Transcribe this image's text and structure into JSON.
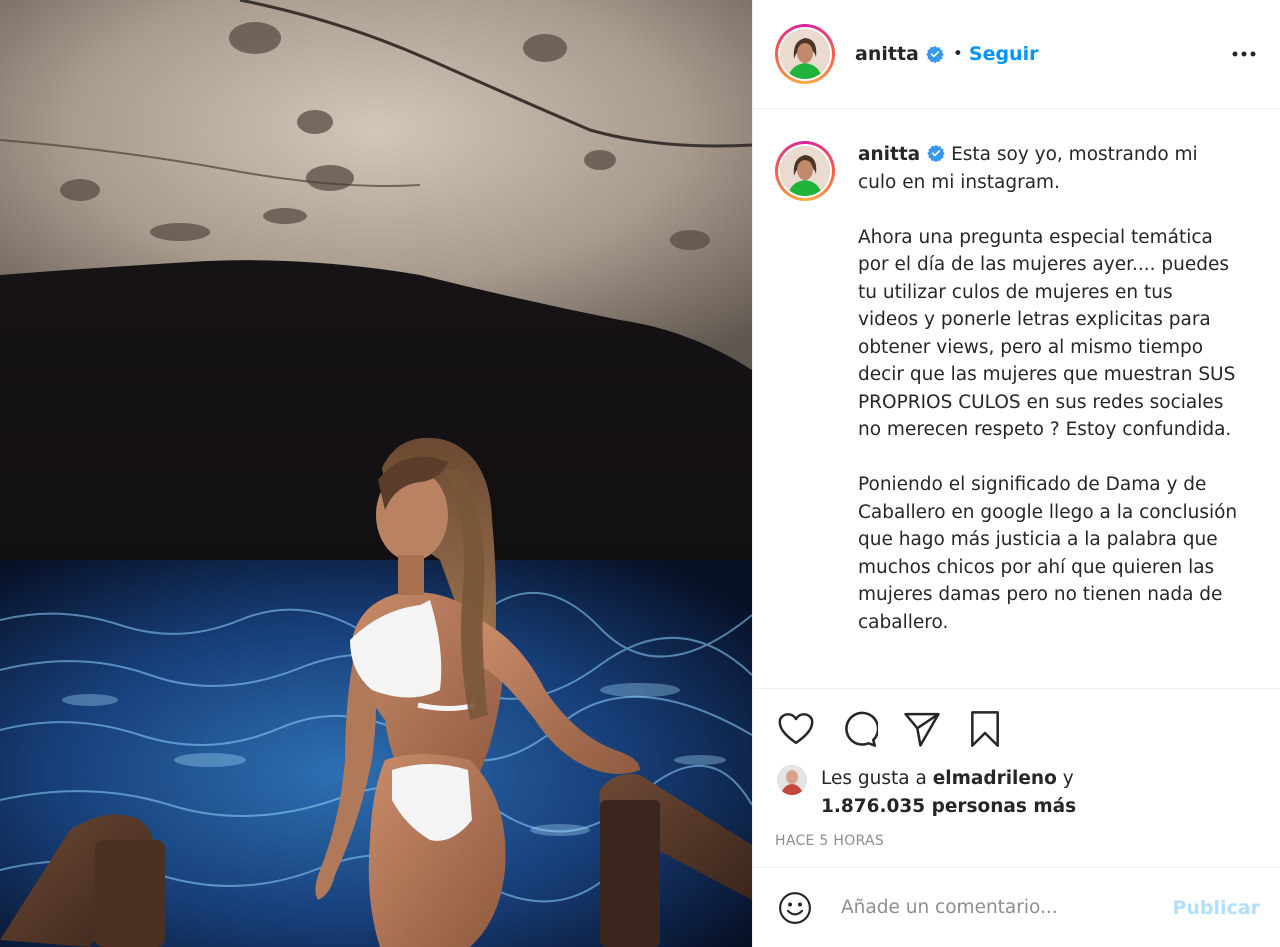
{
  "post": {
    "image": {
      "alt": "Foto de la publicación",
      "scene": "cave-pool-photo"
    },
    "header": {
      "username": "anitta",
      "verified": true,
      "separator": "•",
      "follow_label": "Seguir",
      "more_icon": "more-horizontal-icon"
    },
    "caption": {
      "username": "anitta",
      "paragraphs": [
        "Esta soy yo, mostrando mi culo en mi instagram.",
        "Ahora una pregunta especial temática por el día de las mujeres ayer.... puedes tu utilizar culos de mujeres en tus videos y ponerle letras explicitas para obtener views, pero al mismo tiempo decir que las mujeres que muestran SUS PROPRIOS CULOS en sus redes sociales no merecen respeto ? Estoy confundida.",
        "Poniendo el significado de Dama y de Caballero en google llego a la conclusión que hago más justicia a la palabra que muchos chicos por ahí que quieren las mujeres damas pero no tienen nada de caballero."
      ]
    },
    "actions": {
      "like_icon": "heart-icon",
      "comment_icon": "comment-icon",
      "share_icon": "send-icon",
      "save_icon": "bookmark-icon"
    },
    "likes": {
      "prefix": "Les gusta a ",
      "user": "elmadrileno",
      "conj": " y",
      "count": "1.876.035 personas más"
    },
    "timestamp": "Hace 5 horas",
    "comment": {
      "emoji_icon": "smiley-icon",
      "placeholder": "Añade un comentario...",
      "publish_label": "Publicar"
    }
  },
  "colors": {
    "accent": "#0095f6",
    "publish_disabled": "#b2dffc",
    "text": "#262626",
    "muted": "#8e8e8e",
    "divider": "#efefef"
  }
}
